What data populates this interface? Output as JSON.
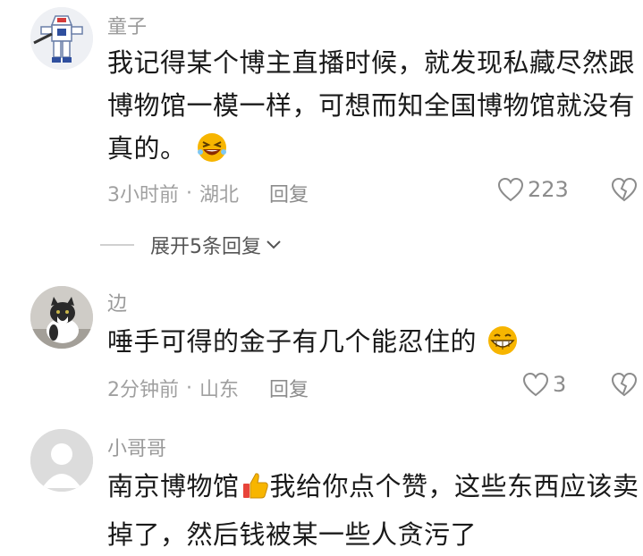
{
  "comments": [
    {
      "username": "童子",
      "text_lines": [
        "我记得某个博主直播时候，就发现私藏尽然跟",
        "博物馆一模一样，可想而知全国博物馆就没有",
        "真的。"
      ],
      "emoji": "laughing-emoji",
      "time": "3小时前",
      "location": "湖北",
      "reply_label": "回复",
      "likes": "223"
    },
    {
      "username": "边",
      "text": "唾手可得的金子有几个能忍住的",
      "emoji": "grinning-emoji",
      "time": "2分钟前",
      "location": "山东",
      "reply_label": "回复",
      "likes": "3"
    },
    {
      "username": "小哥哥",
      "text_line1_a": "南京博物馆",
      "text_line1_b": "我给你点个赞，这些东西应该卖",
      "text_line2": "掉了，然后钱被某一些人贪污了",
      "emoji": "thumbs-up-emoji"
    }
  ],
  "expand_replies": "展开5条回复",
  "meta_separator": "·",
  "colors": {
    "text": "#1a1a1a",
    "muted": "#a0a0a0",
    "divider": "#d0d0d0",
    "emoji": "#f7b500"
  }
}
